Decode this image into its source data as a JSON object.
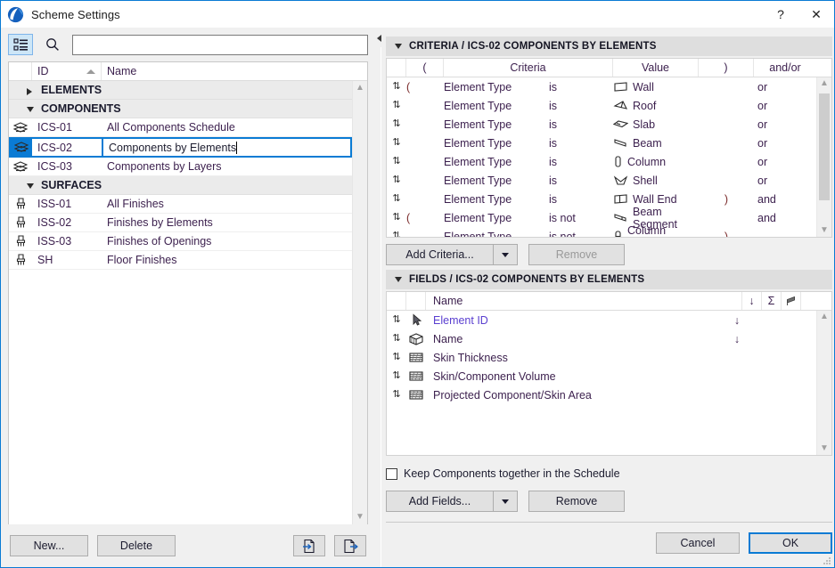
{
  "window": {
    "title": "Scheme Settings",
    "app_icon": "archicad-logo-icon",
    "help_label": "?",
    "close_label": "✕"
  },
  "left_panel": {
    "toolbar": {
      "tree_view_icon": "tree-list-icon",
      "search_icon": "search-icon",
      "search_value": "",
      "search_placeholder": ""
    },
    "columns": {
      "id": "ID",
      "name": "Name"
    },
    "groups": [
      {
        "label": "ELEMENTS",
        "expanded": false,
        "items": []
      },
      {
        "label": "COMPONENTS",
        "expanded": true,
        "items": [
          {
            "icon": "components-schedule-icon",
            "id": "ICS-01",
            "name": "All Components Schedule",
            "selected": false
          },
          {
            "icon": "components-schedule-icon",
            "id": "ICS-02",
            "name": "Components by Elements",
            "selected": true,
            "editing": true
          },
          {
            "icon": "components-schedule-icon",
            "id": "ICS-03",
            "name": "Components by Layers",
            "selected": false
          }
        ]
      },
      {
        "label": "SURFACES",
        "expanded": true,
        "items": [
          {
            "icon": "surface-schedule-icon",
            "id": "ISS-01",
            "name": "All Finishes",
            "selected": false
          },
          {
            "icon": "surface-schedule-icon",
            "id": "ISS-02",
            "name": "Finishes by Elements",
            "selected": false
          },
          {
            "icon": "surface-schedule-icon",
            "id": "ISS-03",
            "name": "Finishes of Openings",
            "selected": false
          },
          {
            "icon": "surface-schedule-icon",
            "id": "SH",
            "name": "Floor Finishes",
            "selected": false
          }
        ]
      }
    ],
    "footer": {
      "new_label": "New...",
      "delete_label": "Delete",
      "import_icon": "import-scheme-icon",
      "export_icon": "export-scheme-icon"
    }
  },
  "criteria": {
    "section_title": "CRITERIA / ICS-02 COMPONENTS BY ELEMENTS",
    "columns": {
      "drag": "",
      "open_paren": "(",
      "criteria": "Criteria",
      "value": "Value",
      "close_paren": ")",
      "and_or": "and/or"
    },
    "rows": [
      {
        "open": "(",
        "field": "Element Type",
        "operator": "is",
        "value_icon": "wall-icon",
        "value": "Wall",
        "close": "",
        "andor": "or"
      },
      {
        "open": "",
        "field": "Element Type",
        "operator": "is",
        "value_icon": "roof-icon",
        "value": "Roof",
        "close": "",
        "andor": "or"
      },
      {
        "open": "",
        "field": "Element Type",
        "operator": "is",
        "value_icon": "slab-icon",
        "value": "Slab",
        "close": "",
        "andor": "or"
      },
      {
        "open": "",
        "field": "Element Type",
        "operator": "is",
        "value_icon": "beam-icon",
        "value": "Beam",
        "close": "",
        "andor": "or"
      },
      {
        "open": "",
        "field": "Element Type",
        "operator": "is",
        "value_icon": "column-icon",
        "value": "Column",
        "close": "",
        "andor": "or"
      },
      {
        "open": "",
        "field": "Element Type",
        "operator": "is",
        "value_icon": "shell-icon",
        "value": "Shell",
        "close": "",
        "andor": "or"
      },
      {
        "open": "",
        "field": "Element Type",
        "operator": "is",
        "value_icon": "wall-end-icon",
        "value": "Wall End",
        "close": ")",
        "andor": "and"
      },
      {
        "open": "(",
        "field": "Element Type",
        "operator": "is not",
        "value_icon": "beam-segment-icon",
        "value": "Beam Segment",
        "close": "",
        "andor": "and"
      },
      {
        "open": "",
        "field": "Element Type",
        "operator": "is not",
        "value_icon": "column-segment-icon",
        "value": "Column Segment",
        "close": ")",
        "andor": ""
      }
    ],
    "add_label": "Add Criteria...",
    "remove_label": "Remove",
    "remove_disabled": true
  },
  "fields": {
    "section_title": "FIELDS / ICS-02 COMPONENTS BY ELEMENTS",
    "columns": {
      "name": "Name",
      "sort_icon": "sort-arrow-icon",
      "sum_icon": "sigma-sum-icon",
      "flag_icon": "flag-icon"
    },
    "rows": [
      {
        "icon": "arrow-pointer-icon",
        "name": "Element ID",
        "sort": "↓"
      },
      {
        "icon": "component-3d-icon",
        "name": "Name",
        "sort": "↓"
      },
      {
        "icon": "skin-layers-icon",
        "name": "Skin Thickness",
        "sort": ""
      },
      {
        "icon": "skin-layers-icon",
        "name": "Skin/Component Volume",
        "sort": ""
      },
      {
        "icon": "skin-layers-icon",
        "name": "Projected Component/Skin Area",
        "sort": ""
      }
    ],
    "keep_together_label": "Keep Components together in the Schedule",
    "keep_together_checked": false,
    "add_label": "Add Fields...",
    "remove_label": "Remove"
  },
  "dialog_buttons": {
    "cancel_label": "Cancel",
    "ok_label": "OK"
  },
  "colors": {
    "accent": "#0a7bd4",
    "section_header_bg": "#dedede",
    "selected_row_bg": "#0a7bd4",
    "text": "#3b1f4d"
  }
}
